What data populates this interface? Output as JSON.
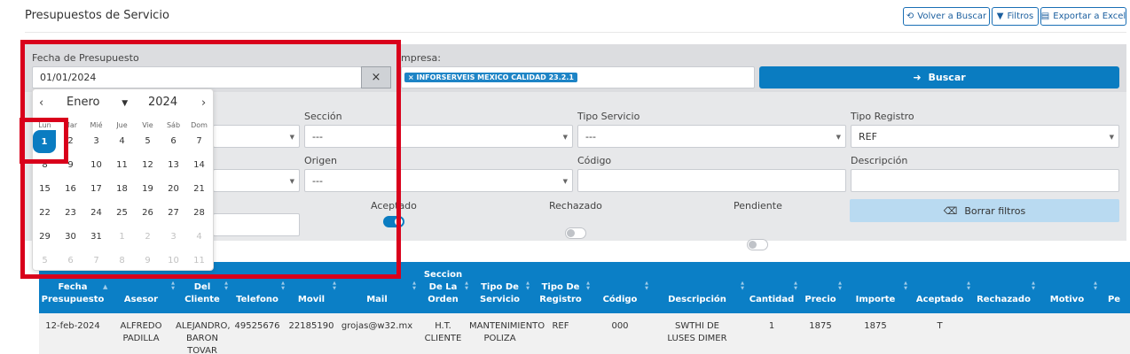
{
  "header": {
    "title": "Presupuestos de Servicio",
    "volver_label": "Volver a Buscar",
    "filtros_label": "Filtros",
    "exportar_label": "Exportar a Excel"
  },
  "filters": {
    "fecha_label": "Fecha de Presupuesto",
    "fecha_value": "01/01/2024",
    "clear_symbol": "×",
    "empresa_label": "mpresa:",
    "empresa_tag": "INFORSERVEIS MEXICO CALIDAD 23.2.1",
    "buscar_label": "Buscar",
    "seccion_label": "Sección",
    "seccion_value": "---",
    "tipo_servicio_label": "Tipo Servicio",
    "tipo_servicio_value": "---",
    "tipo_registro_label": "Tipo Registro",
    "tipo_registro_value": "REF",
    "origen_label": "Origen",
    "origen_value": "---",
    "codigo_label": "Código",
    "descripcion_label": "Descripción",
    "aceptado_label": "Aceptado",
    "rechazado_label": "Rechazado",
    "pendiente_label": "Pendiente",
    "aceptado_on": true,
    "rechazado_on": false,
    "pendiente_on": false,
    "borrar_label": "Borrar filtros"
  },
  "calendar": {
    "month": "Enero",
    "year": "2024",
    "weekdays": [
      "Lun",
      "Mar",
      "Mié",
      "Jue",
      "Vie",
      "Sáb",
      "Dom"
    ],
    "selected_day": "1",
    "weeks": [
      [
        "1",
        "2",
        "3",
        "4",
        "5",
        "6",
        "7"
      ],
      [
        "8",
        "9",
        "10",
        "11",
        "12",
        "13",
        "14"
      ],
      [
        "15",
        "16",
        "17",
        "18",
        "19",
        "20",
        "21"
      ],
      [
        "22",
        "23",
        "24",
        "25",
        "26",
        "27",
        "28"
      ],
      [
        "29",
        "30",
        "31",
        "1",
        "2",
        "3",
        "4"
      ],
      [
        "5",
        "6",
        "7",
        "8",
        "9",
        "10",
        "11"
      ]
    ]
  },
  "table": {
    "headers": [
      "Fecha Presupuesto",
      "Asesor",
      "Nombre Del Cliente",
      "Telefono",
      "Movil",
      "Mail",
      "Seccion De La Orden",
      "Tipo De Servicio",
      "Tipo De Registro",
      "Código",
      "Descripción",
      "Cantidad",
      "Precio",
      "Importe",
      "Aceptado",
      "Rechazado",
      "Motivo",
      "Pe"
    ],
    "header_lines": [
      [
        "Fecha",
        "Presupuesto"
      ],
      [
        "Asesor"
      ],
      [
        "Del",
        "Cliente"
      ],
      [
        "Telefono"
      ],
      [
        "Movil"
      ],
      [
        "Mail"
      ],
      [
        "Seccion",
        "De La",
        "Orden"
      ],
      [
        "Tipo De",
        "Servicio"
      ],
      [
        "Tipo De",
        "Registro"
      ],
      [
        "Código"
      ],
      [
        "Descripción"
      ],
      [
        "Cantidad"
      ],
      [
        "Precio"
      ],
      [
        "Importe"
      ],
      [
        "Aceptado"
      ],
      [
        "Rechazado"
      ],
      [
        "Motivo"
      ],
      [
        "Pe"
      ]
    ],
    "rows": [
      [
        [
          "12-feb-2024"
        ],
        [
          "ALFREDO",
          "PADILLA"
        ],
        [
          "ALEJANDRO,",
          "BARON",
          "TOVAR"
        ],
        [
          "49525676"
        ],
        [
          "22185190"
        ],
        [
          "grojas@w32.mx"
        ],
        [
          "H.T.",
          "CLIENTE"
        ],
        [
          "MANTENIMIENTO",
          "POLIZA"
        ],
        [
          "REF"
        ],
        [
          "000"
        ],
        [
          "SWTHI DE",
          "LUSES DIMER"
        ],
        [
          "1"
        ],
        [
          "1875"
        ],
        [
          "1875"
        ],
        [
          "T"
        ],
        [
          ""
        ],
        [
          ""
        ],
        [
          ""
        ]
      ]
    ]
  },
  "colors": {
    "primary": "#0a7cc1",
    "highlight": "#d9001b"
  }
}
